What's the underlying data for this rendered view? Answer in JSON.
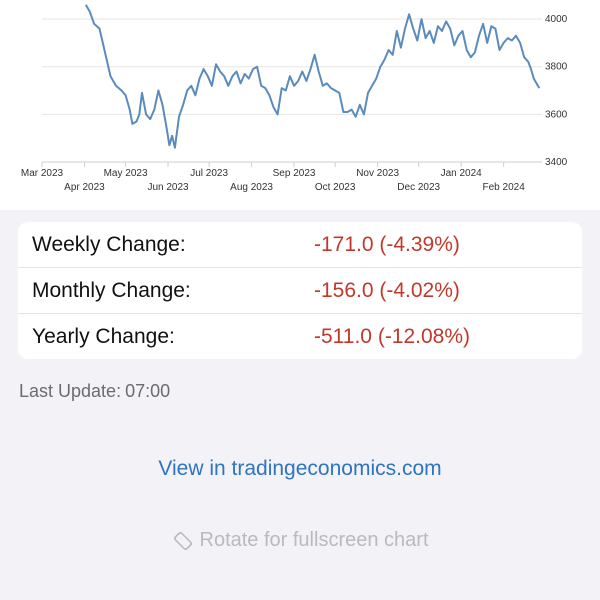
{
  "chart_data": {
    "type": "line",
    "x_labels_row1": [
      "Mar 2023",
      "May 2023",
      "Jul 2023",
      "Sep 2023",
      "Nov 2023",
      "Jan 2024"
    ],
    "x_labels_row2": [
      "Apr 2023",
      "Jun 2023",
      "Aug 2023",
      "Oct 2023",
      "Dec 2023",
      "Feb 2024"
    ],
    "y_ticks": [
      4000,
      3800,
      3600,
      3400
    ],
    "ylim": [
      3400,
      4080
    ],
    "xlim": [
      "2023-03-01",
      "2024-02-29"
    ],
    "grid": true,
    "color": "#5b8bbd",
    "x": [
      "2023-04-02",
      "2023-04-05",
      "2023-04-08",
      "2023-04-12",
      "2023-04-16",
      "2023-04-20",
      "2023-04-24",
      "2023-04-28",
      "2023-05-01",
      "2023-05-04",
      "2023-05-06",
      "2023-05-09",
      "2023-05-11",
      "2023-05-13",
      "2023-05-16",
      "2023-05-19",
      "2023-05-22",
      "2023-05-25",
      "2023-05-28",
      "2023-05-31",
      "2023-06-02",
      "2023-06-04",
      "2023-06-06",
      "2023-06-09",
      "2023-06-12",
      "2023-06-15",
      "2023-06-18",
      "2023-06-21",
      "2023-06-24",
      "2023-06-27",
      "2023-06-30",
      "2023-07-03",
      "2023-07-06",
      "2023-07-09",
      "2023-07-12",
      "2023-07-15",
      "2023-07-18",
      "2023-07-21",
      "2023-07-24",
      "2023-07-27",
      "2023-07-30",
      "2023-08-02",
      "2023-08-05",
      "2023-08-08",
      "2023-08-11",
      "2023-08-14",
      "2023-08-17",
      "2023-08-20",
      "2023-08-23",
      "2023-08-26",
      "2023-08-29",
      "2023-09-01",
      "2023-09-04",
      "2023-09-07",
      "2023-09-10",
      "2023-09-13",
      "2023-09-16",
      "2023-09-19",
      "2023-09-22",
      "2023-09-25",
      "2023-09-28",
      "2023-10-01",
      "2023-10-04",
      "2023-10-07",
      "2023-10-10",
      "2023-10-13",
      "2023-10-16",
      "2023-10-19",
      "2023-10-22",
      "2023-10-25",
      "2023-10-28",
      "2023-10-31",
      "2023-11-03",
      "2023-11-06",
      "2023-11-09",
      "2023-11-12",
      "2023-11-15",
      "2023-11-18",
      "2023-11-21",
      "2023-11-24",
      "2023-11-27",
      "2023-11-30",
      "2023-12-03",
      "2023-12-06",
      "2023-12-09",
      "2023-12-12",
      "2023-12-15",
      "2023-12-18",
      "2023-12-21",
      "2023-12-24",
      "2023-12-27",
      "2023-12-30",
      "2024-01-02",
      "2024-01-05",
      "2024-01-08",
      "2024-01-11",
      "2024-01-14",
      "2024-01-17",
      "2024-01-20",
      "2024-01-23",
      "2024-01-26",
      "2024-01-29",
      "2024-02-01",
      "2024-02-04",
      "2024-02-07",
      "2024-02-10",
      "2024-02-13",
      "2024-02-16",
      "2024-02-19",
      "2024-02-21",
      "2024-02-23",
      "2024-02-25",
      "2024-02-27"
    ],
    "y": [
      4060,
      4030,
      3980,
      3960,
      3860,
      3760,
      3720,
      3700,
      3680,
      3620,
      3560,
      3570,
      3600,
      3690,
      3600,
      3580,
      3620,
      3700,
      3640,
      3540,
      3470,
      3510,
      3460,
      3590,
      3640,
      3700,
      3720,
      3680,
      3750,
      3790,
      3760,
      3720,
      3810,
      3780,
      3760,
      3720,
      3760,
      3780,
      3730,
      3770,
      3750,
      3790,
      3800,
      3720,
      3710,
      3680,
      3630,
      3600,
      3710,
      3700,
      3760,
      3720,
      3740,
      3780,
      3740,
      3790,
      3850,
      3780,
      3720,
      3730,
      3710,
      3700,
      3690,
      3610,
      3610,
      3620,
      3590,
      3640,
      3600,
      3690,
      3720,
      3750,
      3800,
      3830,
      3870,
      3850,
      3950,
      3880,
      3960,
      4020,
      3960,
      3910,
      4000,
      3920,
      3950,
      3900,
      3970,
      3950,
      3990,
      3960,
      3890,
      3930,
      3950,
      3870,
      3840,
      3860,
      3930,
      3980,
      3900,
      3970,
      3960,
      3870,
      3900,
      3920,
      3910,
      3930,
      3900,
      3840,
      3820,
      3790,
      3750,
      3730,
      3710
    ]
  },
  "stats": [
    {
      "label": "Weekly Change:",
      "value": "-171.0 (-4.39%)"
    },
    {
      "label": "Monthly Change:",
      "value": "-156.0 (-4.02%)"
    },
    {
      "label": "Yearly Change:",
      "value": "-511.0 (-12.08%)"
    }
  ],
  "last_update": {
    "label": "Last Update:",
    "time": "07:00"
  },
  "link_text": "View in tradingeconomics.com",
  "rotate": {
    "text": "Rotate for fullscreen chart",
    "icon": "rotate-icon"
  },
  "colors": {
    "line": "#5b8bbd",
    "negative": "#c0392b",
    "link": "#2f74c0"
  }
}
